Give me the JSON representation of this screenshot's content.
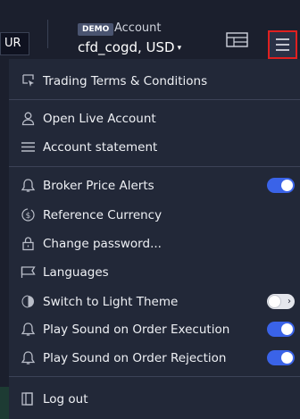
{
  "header": {
    "currency_tab": "UR",
    "demo_badge": "DEMO",
    "account_label": "Account",
    "account_name": "cfd_cogd, USD",
    "account_caret": "▾"
  },
  "menu": {
    "items": [
      {
        "label": "Trading Terms & Conditions",
        "icon": "clipboard-cursor-icon"
      },
      {
        "label": "Open Live Account",
        "icon": "user-icon"
      },
      {
        "label": "Account statement",
        "icon": "list-lines-icon"
      },
      {
        "label": "Broker Price Alerts",
        "icon": "bell-icon",
        "toggle": true
      },
      {
        "label": "Reference Currency",
        "icon": "currency-cycle-icon"
      },
      {
        "label": "Change password...",
        "icon": "lock-icon"
      },
      {
        "label": "Languages",
        "icon": "flag-icon"
      },
      {
        "label": "Switch to Light Theme",
        "icon": "theme-icon",
        "toggle": false
      },
      {
        "label": "Play Sound on Order Execution",
        "icon": "bell-icon",
        "toggle": true
      },
      {
        "label": "Play Sound on Order Rejection",
        "icon": "bell-icon",
        "toggle": true
      },
      {
        "label": "Log out",
        "icon": "logout-icon"
      }
    ]
  },
  "colors": {
    "background": "#1b1f2d",
    "menu_background": "#222838",
    "toggle_on": "#3a63e8",
    "highlight_border": "#e02020"
  }
}
